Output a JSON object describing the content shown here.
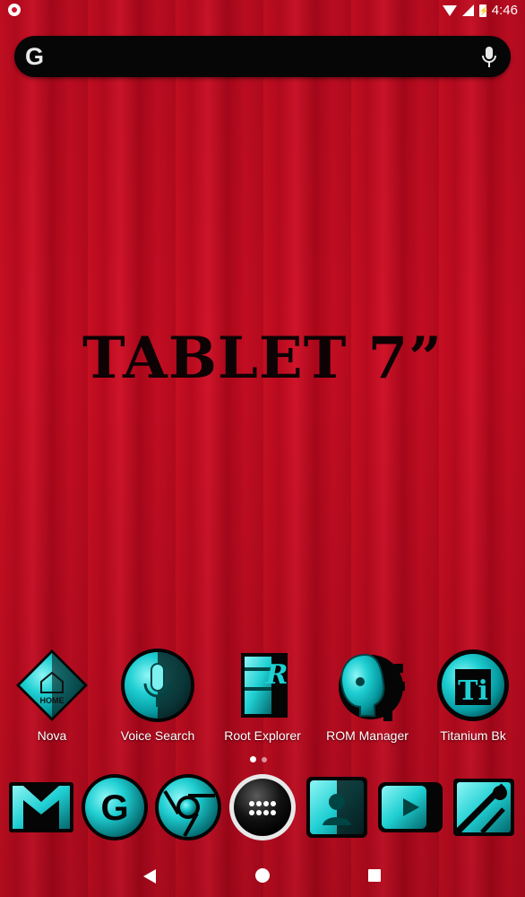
{
  "status_bar": {
    "time": "4:46",
    "battery_glyph": "⚡",
    "icons": [
      "record-icon",
      "wifi-icon",
      "signal-icon",
      "battery-icon"
    ]
  },
  "search_bar": {
    "logo": "G",
    "mic_icon": "mic-icon"
  },
  "wallpaper_text": "TABLET 7”",
  "apps": [
    {
      "label": "Nova",
      "icon": "nova-home-icon",
      "inner": "HOME"
    },
    {
      "label": "Voice Search",
      "icon": "voice-search-icon"
    },
    {
      "label": "Root Explorer",
      "icon": "root-explorer-icon",
      "inner": "R"
    },
    {
      "label": "ROM Manager",
      "icon": "rom-manager-icon"
    },
    {
      "label": "Titanium Bk",
      "icon": "titanium-backup-icon",
      "inner": "Ti"
    }
  ],
  "page_indicator": {
    "pages": 2,
    "current": 1
  },
  "dock": [
    {
      "icon": "gmail-icon"
    },
    {
      "icon": "google-icon",
      "inner": "G"
    },
    {
      "icon": "chrome-icon"
    },
    {
      "icon": "app-drawer-icon"
    },
    {
      "icon": "contacts-icon"
    },
    {
      "icon": "youtube-icon"
    },
    {
      "icon": "google-maps-icon"
    }
  ],
  "nav": {
    "back": "back-icon",
    "home": "home-icon",
    "recents": "recents-icon"
  },
  "colors": {
    "wallpaper": "#c20d22",
    "icon_teal": "#1fcfd2",
    "search_bg": "#060606"
  }
}
